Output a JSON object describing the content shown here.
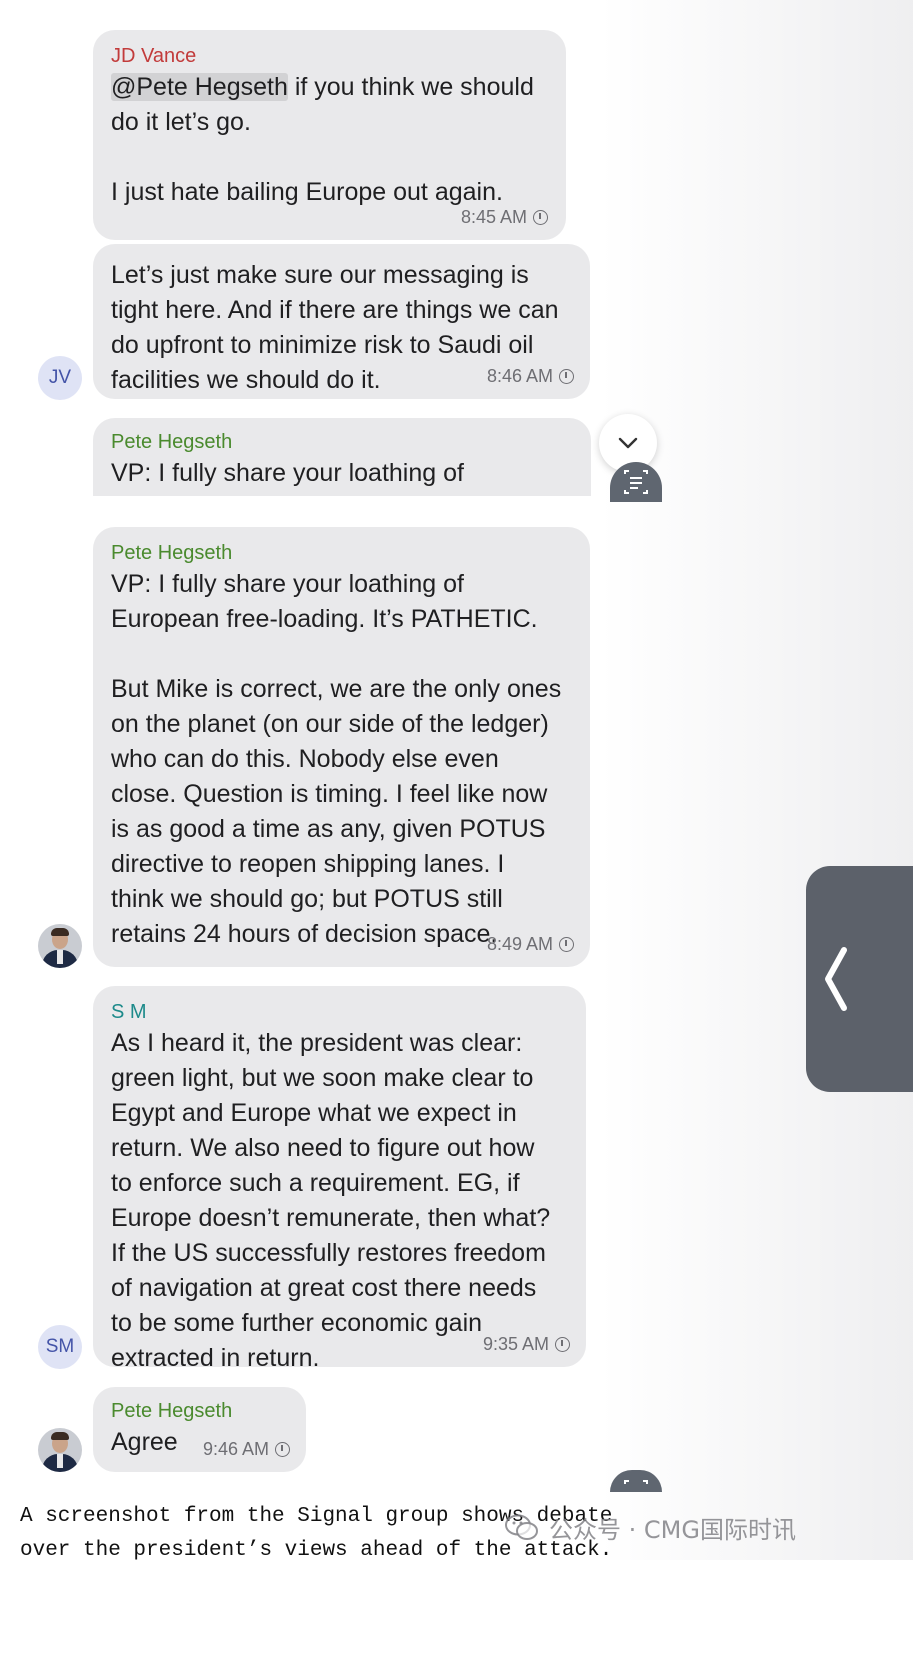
{
  "messages": [
    {
      "sender": "JD Vance",
      "mention": "@Pete Hegseth",
      "text_after_mention": " if you think we should\ndo it let’s go.\n\nI just hate bailing Europe out again.",
      "time": "8:45 AM"
    },
    {
      "text": "Let’s just make sure our messaging is\ntight here. And if there are things we can\ndo upfront to minimize risk to Saudi oil\nfacilities we should do it.",
      "time": "8:46 AM",
      "avatar_initials": "JV"
    },
    {
      "sender": "Pete Hegseth",
      "text": "VP: I fully share your loathing of\nEuropean free-loading. It’s PATHETIC."
    },
    {
      "sender": "Pete Hegseth",
      "text": "VP: I fully share your loathing of\nEuropean free-loading. It’s PATHETIC.\n\nBut Mike is correct, we are the only ones\non the planet (on our side of the ledger)\nwho can do this. Nobody else even\nclose. Question is timing. I feel like now\nis as good a time as any, given POTUS\ndirective to reopen shipping lanes. I\nthink we should go; but POTUS still\nretains 24 hours of decision space.",
      "time": "8:49 AM"
    },
    {
      "sender": "S M",
      "text": "As I heard it, the president was clear:\ngreen light, but we soon make clear to\nEgypt and Europe what we expect in\nreturn. We also need to figure out how\nto enforce such a requirement. EG, if\nEurope doesn’t remunerate, then what?\nIf the US successfully restores freedom\nof navigation at great cost there needs\nto be some further economic gain\nextracted in return.",
      "time": "9:35 AM",
      "avatar_initials": "SM"
    },
    {
      "sender": "Pete Hegseth",
      "text": "Agree",
      "time": "9:46 AM"
    }
  ],
  "caption": {
    "line1": "A screenshot from the Signal group shows debate",
    "line2": "over the president’s views ahead of the attack."
  },
  "watermark": "公众号 · CMG国际时讯",
  "icons": {
    "scroll_down": "chevron-down-icon",
    "scan": "scan-text-icon",
    "side_panel": "chevron-left-icon",
    "message_time": "clock-icon",
    "watermark": "wechat-icon"
  },
  "colors": {
    "bubble": "#e9e9eb",
    "sender_jd_vance": "#c23b3b",
    "sender_pete_hegseth": "#4a8a2e",
    "sender_s_m": "#1d8a8a",
    "initials_avatar": "#dfe3f5"
  }
}
